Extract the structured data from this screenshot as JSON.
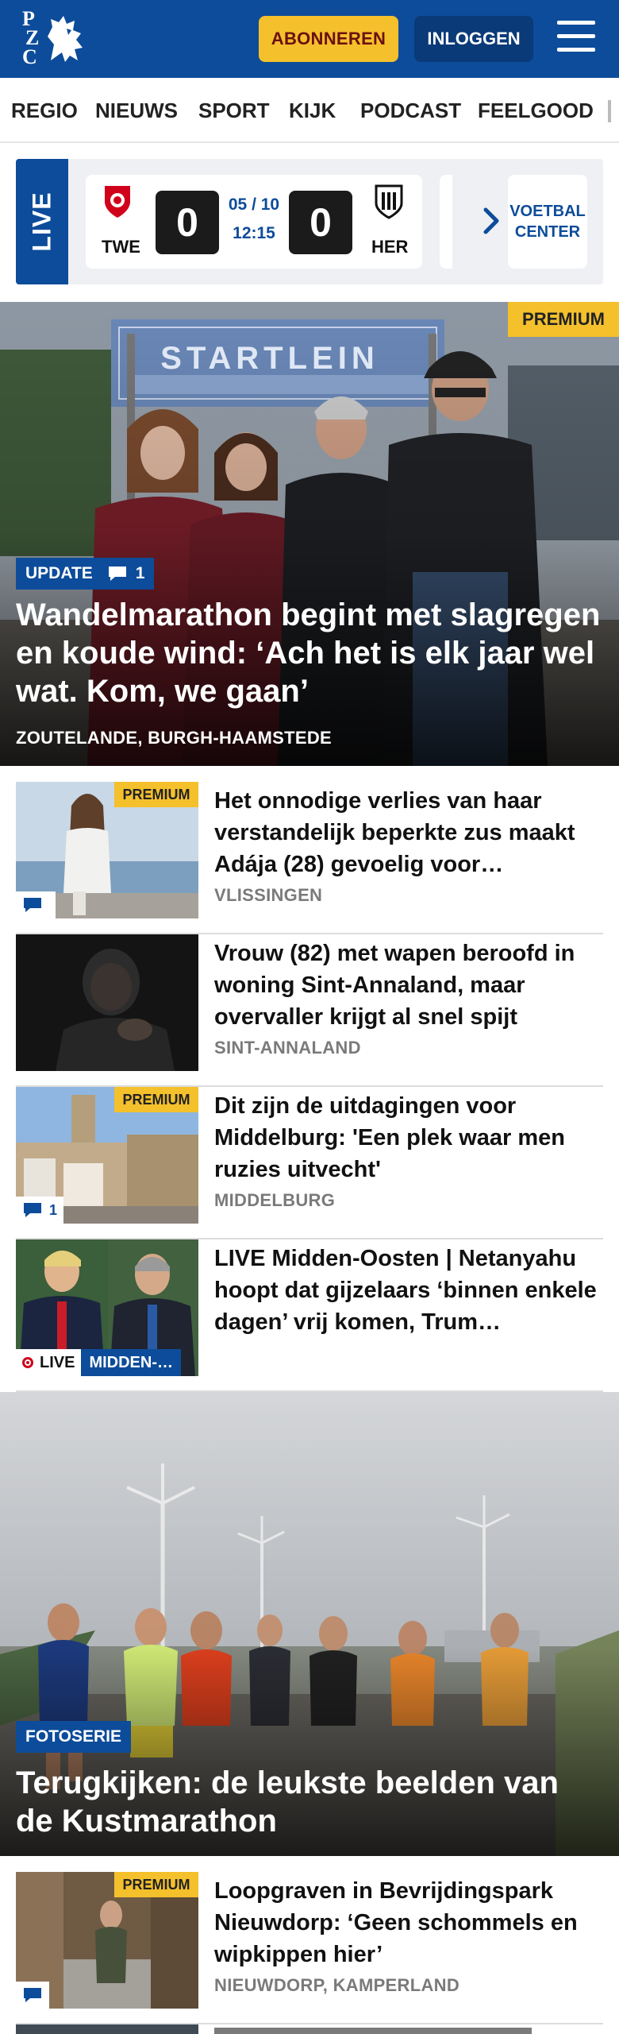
{
  "header": {
    "logo_letters": [
      "P",
      "Z",
      "C"
    ],
    "subscribe_label": "ABONNEREN",
    "login_label": "INLOGGEN"
  },
  "nav": {
    "items": [
      "REGIO",
      "NIEUWS",
      "SPORT",
      "KIJK",
      "PODCAST",
      "FEELGOOD"
    ]
  },
  "live": {
    "tab_label": "LIVE",
    "match": {
      "home": "TWE",
      "away": "HER",
      "home_score": "0",
      "away_score": "0",
      "date": "05 / 10",
      "time": "12:15"
    },
    "voetbal_center_line1": "VOETBAL",
    "voetbal_center_line2": "CENTER"
  },
  "hero": {
    "premium": "PREMIUM",
    "badge": "UPDATE",
    "comments": "1",
    "banner_text": "STARTLEIN",
    "title": "Wandelmarathon begint met slagregen en koude wind: ‘Ach het is elk jaar wel wat. Kom, we gaan’",
    "location": "ZOUTELANDE, BURGH-HAAMSTEDE"
  },
  "articles": [
    {
      "premium": "PREMIUM",
      "comments": "",
      "title": "Het onnodige verlies van haar verstandelijk beperkte zus maakt Adája (28) gevoelig voor…",
      "location": "VLISSINGEN"
    },
    {
      "title": "Vrouw (82) met wapen beroofd in woning Sint-Annaland, maar overvaller krijgt al snel spijt",
      "location": "SINT-ANNALAND"
    },
    {
      "premium": "PREMIUM",
      "comments": "1",
      "title": "Dit zijn de uitdagingen voor Middelburg: 'Een plek waar men ruzies uitvecht'",
      "location": "MIDDELBURG"
    },
    {
      "title": "LIVE Midden-Oosten | Netanyahu hoopt dat gijzelaars ‘binnen enkele dagen’ vrij komen, Trum…",
      "live_label": "LIVE",
      "live_category": "MIDDEN-…"
    }
  ],
  "hero2": {
    "badge": "FOTOSERIE",
    "title": "Terugkijken: de leukste beelden van de Kustmarathon"
  },
  "article5": {
    "premium": "PREMIUM",
    "title": "Loopgraven in Bevrijdingspark Nieuwdorp: ‘Geen schommels en wipkippen hier’",
    "location": "NIEUWDORP, KAMPERLAND"
  },
  "colors": {
    "brand_blue": "#0d4c9a",
    "premium_yellow": "#f4c02c",
    "live_red": "#d0021b"
  }
}
